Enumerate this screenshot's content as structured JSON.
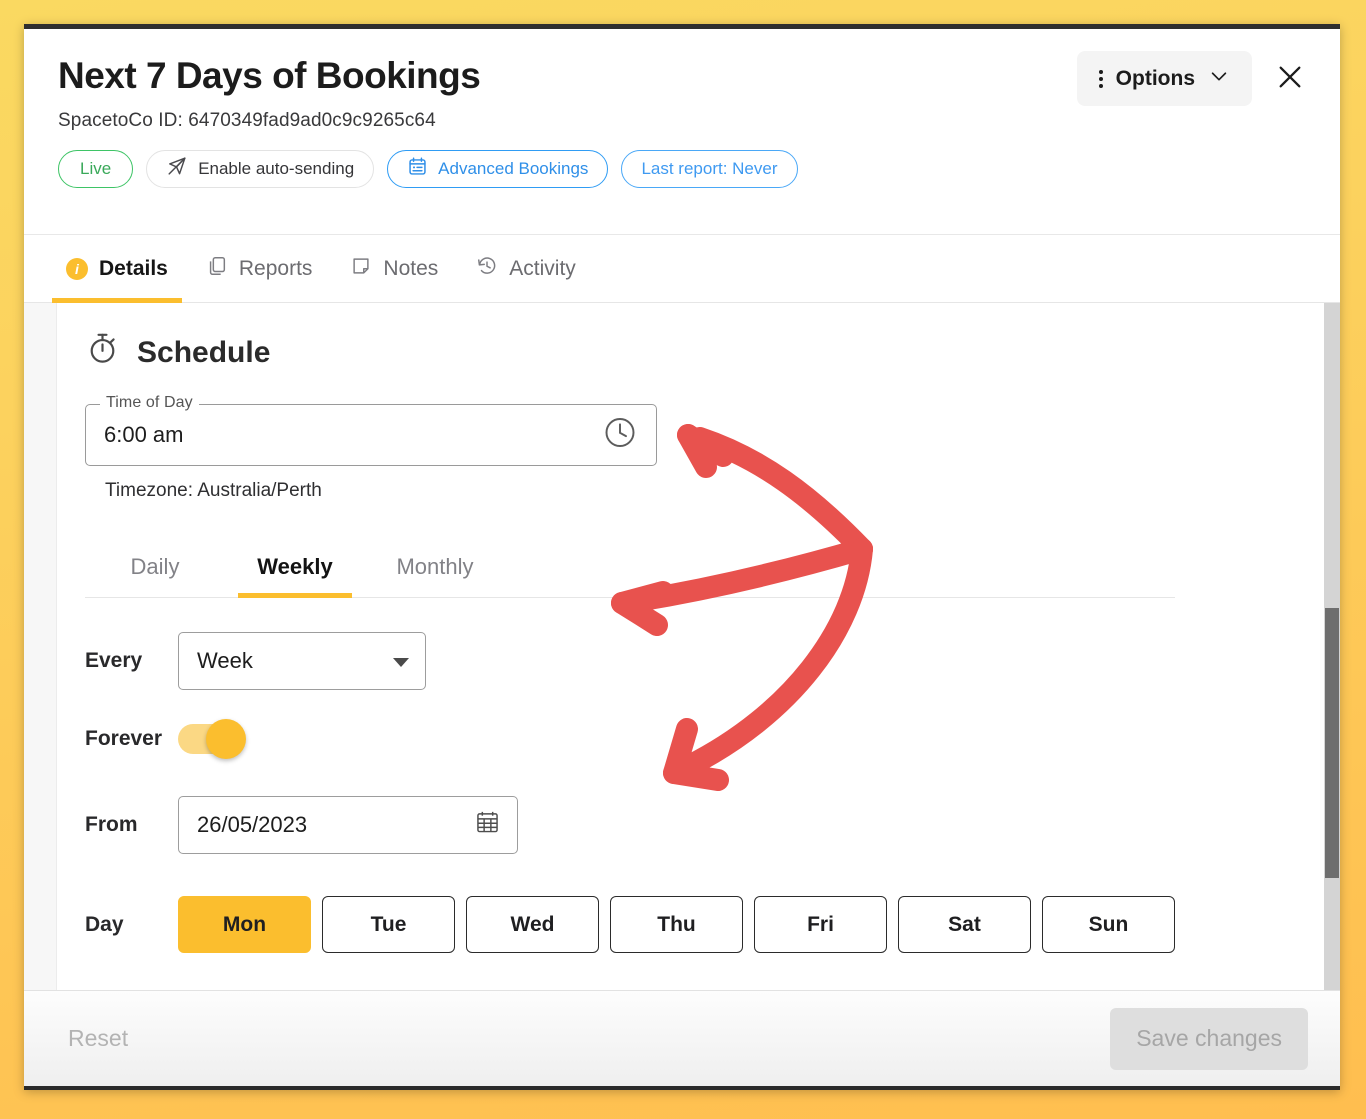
{
  "header": {
    "title": "Next 7 Days of Bookings",
    "subtitle": "SpacetoCo ID: 6470349fad9ad0c9c9265c64",
    "pills": [
      {
        "label": "Live",
        "style": "live",
        "icon": null
      },
      {
        "label": "Enable auto-sending",
        "style": "grey",
        "icon": "send-off-icon"
      },
      {
        "label": "Advanced Bookings",
        "style": "blue",
        "icon": "calendar-list-icon"
      },
      {
        "label": "Last report: Never",
        "style": "blue2",
        "icon": null
      }
    ],
    "options_label": "Options",
    "close_label": "Close"
  },
  "tabs": [
    {
      "label": "Details",
      "icon": "info-circle-icon",
      "active": true
    },
    {
      "label": "Reports",
      "icon": "copy-icon",
      "active": false
    },
    {
      "label": "Notes",
      "icon": "note-icon",
      "active": false
    },
    {
      "label": "Activity",
      "icon": "history-icon",
      "active": false
    }
  ],
  "schedule": {
    "section_title": "Schedule",
    "section_icon": "stopwatch-icon",
    "time_of_day": {
      "legend": "Time of Day",
      "value": "6:00 am",
      "icon": "clock-icon"
    },
    "timezone": "Timezone: Australia/Perth",
    "frequency_tabs": [
      {
        "label": "Daily",
        "active": false
      },
      {
        "label": "Weekly",
        "active": true
      },
      {
        "label": "Monthly",
        "active": false
      }
    ],
    "every": {
      "label": "Every",
      "value": "Week",
      "options": [
        "Week"
      ]
    },
    "forever": {
      "label": "Forever",
      "enabled": true
    },
    "from": {
      "label": "From",
      "value": "26/05/2023",
      "icon": "calendar-icon"
    },
    "day": {
      "label": "Day",
      "buttons": [
        {
          "label": "Mon",
          "selected": true
        },
        {
          "label": "Tue",
          "selected": false
        },
        {
          "label": "Wed",
          "selected": false
        },
        {
          "label": "Thu",
          "selected": false
        },
        {
          "label": "Fri",
          "selected": false
        },
        {
          "label": "Sat",
          "selected": false
        },
        {
          "label": "Sun",
          "selected": false
        }
      ]
    }
  },
  "footer": {
    "reset_label": "Reset",
    "save_label": "Save changes"
  },
  "annotation": {
    "color": "#e8524e",
    "arrow_count": 3
  },
  "colors": {
    "frame_yellow": "#fad961",
    "frame_orange": "#ffbe4f",
    "accent_yellow": "#fbbe2e",
    "live_green": "#3aa95a",
    "link_blue": "#2f8fe8",
    "annotation_red": "#e8524e"
  }
}
